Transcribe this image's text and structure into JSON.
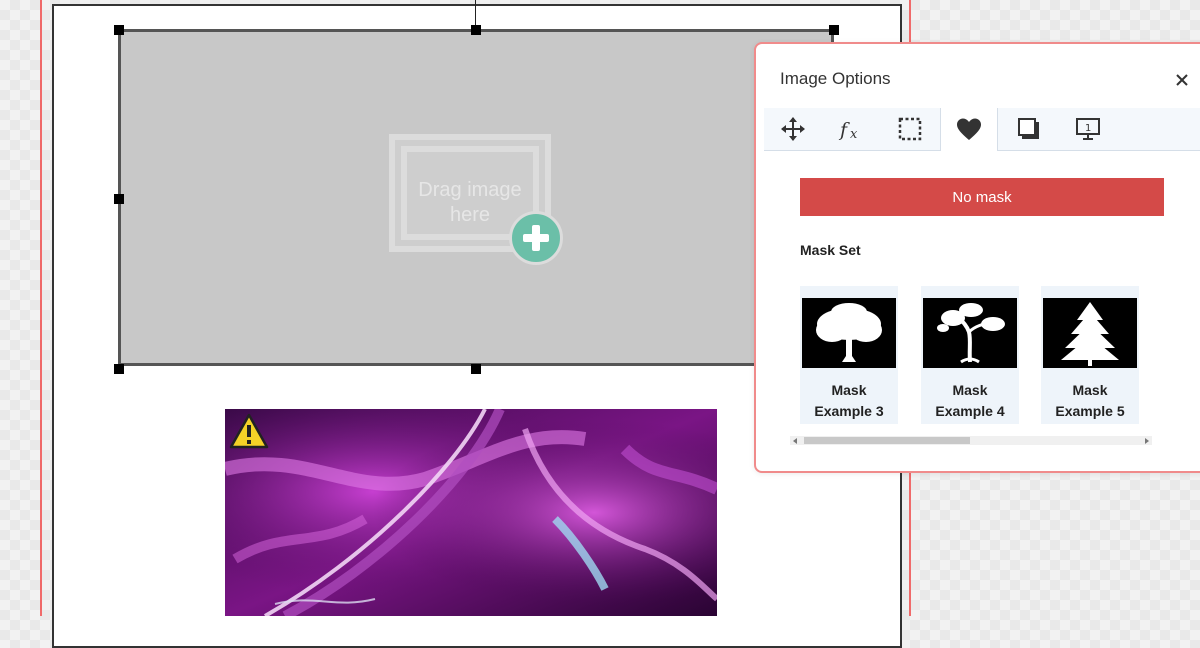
{
  "canvas": {
    "guide_color": "#f06a6a",
    "drop_target": {
      "label": "Drag image\nhere",
      "icon": "add-image-plus-icon"
    },
    "warning": {
      "icon": "warning-icon"
    }
  },
  "image_options_panel": {
    "title": "Image Options",
    "close_icon": "close-icon",
    "tabs": [
      {
        "icon": "move-icon",
        "active": false
      },
      {
        "icon": "effects-fx-icon",
        "active": false
      },
      {
        "icon": "crop-selection-icon",
        "active": false
      },
      {
        "icon": "heart-mask-icon",
        "active": true
      },
      {
        "icon": "shadow-icon",
        "active": false
      },
      {
        "icon": "display-screen-icon",
        "active": false
      }
    ],
    "no_mask_label": "No mask",
    "mask_set_label": "Mask Set",
    "masks": [
      {
        "label": "Mask\nExample 3",
        "thumb": "broadleaf-tree"
      },
      {
        "label": "Mask\nExample 4",
        "thumb": "bonsai-tree"
      },
      {
        "label": "Mask\nExample 5",
        "thumb": "fir-tree"
      }
    ],
    "accent_color": "#d44a48",
    "border_color": "#f08b8b"
  }
}
